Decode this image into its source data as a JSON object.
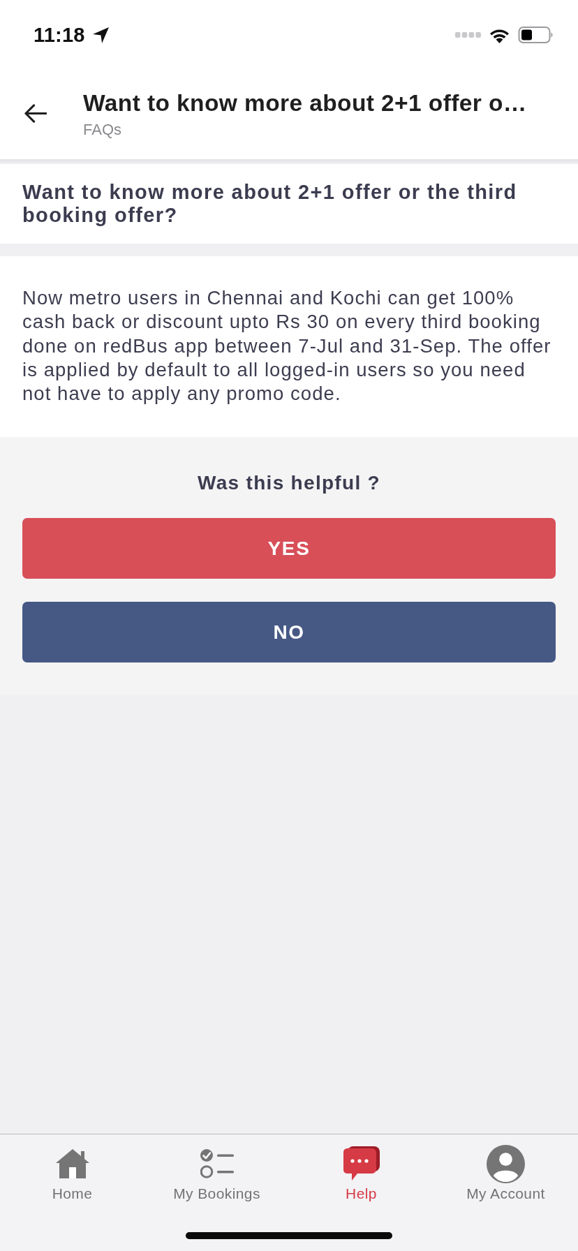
{
  "status_bar": {
    "time": "11:18"
  },
  "header": {
    "title": "Want to know more about 2+1 offer o…",
    "subtitle": "FAQs"
  },
  "question": "Want to know more about 2+1 offer or the third booking offer?",
  "answer": "Now metro users in Chennai and Kochi can get 100% cash back or discount upto Rs 30 on every third booking done on redBus app between 7-Jul and 31-Sep. The offer is applied by default to all logged-in users so you need not have to apply any promo code.",
  "feedback": {
    "prompt": "Was this helpful ?",
    "buttons": [
      {
        "label": "YES",
        "kind": "positive"
      },
      {
        "label": "NO",
        "kind": "negative"
      }
    ]
  },
  "tab_bar": [
    {
      "label": "Home",
      "selected": false
    },
    {
      "label": "My Bookings",
      "selected": false
    },
    {
      "label": "Help",
      "selected": true
    },
    {
      "label": "My Account",
      "selected": false
    }
  ]
}
